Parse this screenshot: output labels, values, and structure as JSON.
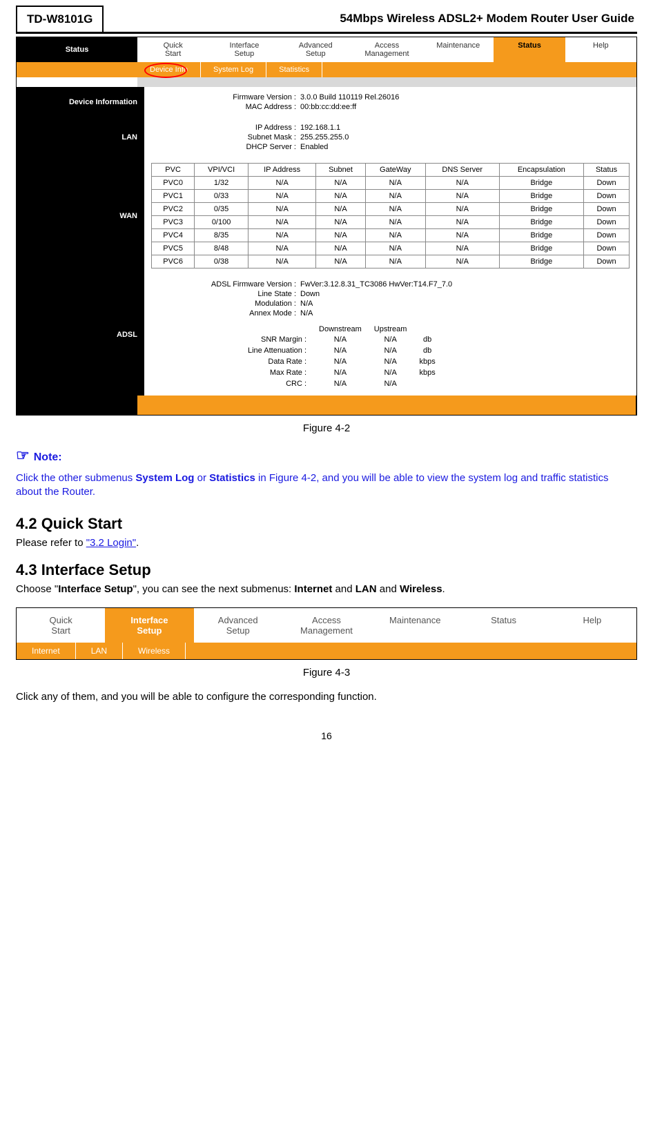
{
  "header": {
    "model": "TD-W8101G",
    "title": "54Mbps Wireless ADSL2+ Modem Router User Guide"
  },
  "shot1": {
    "sidebar_status": "Status",
    "tabs": [
      "Quick\nStart",
      "Interface\nSetup",
      "Advanced\nSetup",
      "Access\nManagement",
      "Maintenance",
      "Status",
      "Help"
    ],
    "active_tab": 5,
    "subtabs": [
      "Device Info",
      "System Log",
      "Statistics"
    ],
    "active_sub": 0,
    "section_device": "Device Information",
    "dev": {
      "fw_l": "Firmware Version :",
      "fw_v": "3.0.0 Build 110119 Rel.26016",
      "mac_l": "MAC Address :",
      "mac_v": "00:bb:cc:dd:ee:ff"
    },
    "section_lan": "LAN",
    "lan": {
      "ip_l": "IP Address :",
      "ip_v": "192.168.1.1",
      "sm_l": "Subnet Mask :",
      "sm_v": "255.255.255.0",
      "dh_l": "DHCP Server :",
      "dh_v": "Enabled"
    },
    "section_wan": "WAN",
    "wan_headers": [
      "PVC",
      "VPI/VCI",
      "IP Address",
      "Subnet",
      "GateWay",
      "DNS Server",
      "Encapsulation",
      "Status"
    ],
    "wan_rows": [
      [
        "PVC0",
        "1/32",
        "N/A",
        "N/A",
        "N/A",
        "N/A",
        "Bridge",
        "Down"
      ],
      [
        "PVC1",
        "0/33",
        "N/A",
        "N/A",
        "N/A",
        "N/A",
        "Bridge",
        "Down"
      ],
      [
        "PVC2",
        "0/35",
        "N/A",
        "N/A",
        "N/A",
        "N/A",
        "Bridge",
        "Down"
      ],
      [
        "PVC3",
        "0/100",
        "N/A",
        "N/A",
        "N/A",
        "N/A",
        "Bridge",
        "Down"
      ],
      [
        "PVC4",
        "8/35",
        "N/A",
        "N/A",
        "N/A",
        "N/A",
        "Bridge",
        "Down"
      ],
      [
        "PVC5",
        "8/48",
        "N/A",
        "N/A",
        "N/A",
        "N/A",
        "Bridge",
        "Down"
      ],
      [
        "PVC6",
        "0/38",
        "N/A",
        "N/A",
        "N/A",
        "N/A",
        "Bridge",
        "Down"
      ]
    ],
    "section_adsl": "ADSL",
    "adsl": {
      "fw_l": "ADSL Firmware Version :",
      "fw_v": "FwVer:3.12.8.31_TC3086 HwVer:T14.F7_7.0",
      "ls_l": "Line State :",
      "ls_v": "Down",
      "mod_l": "Modulation :",
      "mod_v": "N/A",
      "an_l": "Annex Mode :",
      "an_v": "N/A",
      "cols": [
        "Downstream",
        "Upstream",
        ""
      ],
      "rows": [
        [
          "SNR Margin :",
          "N/A",
          "N/A",
          "db"
        ],
        [
          "Line Attenuation :",
          "N/A",
          "N/A",
          "db"
        ],
        [
          "Data Rate :",
          "N/A",
          "N/A",
          "kbps"
        ],
        [
          "Max Rate :",
          "N/A",
          "N/A",
          "kbps"
        ],
        [
          "CRC :",
          "N/A",
          "N/A",
          ""
        ]
      ]
    }
  },
  "caption1": "Figure 4-2",
  "note_h": "Note:",
  "note_p_pre": "Click the other submenus ",
  "note_p_b1": "System Log",
  "note_p_mid": " or ",
  "note_p_b2": "Statistics",
  "note_p_post": " in Figure 4-2, and you will be able to view the system log and traffic statistics about the Router.",
  "sect42": "4.2    Quick Start",
  "p42_pre": "Please refer to ",
  "p42_link": "\"3.2 Login\"",
  "p42_post": ".",
  "sect43": "4.3    Interface Setup",
  "p43_pre": "Choose \"",
  "p43_b": "Interface Setup",
  "p43_mid": "\", you can see the next submenus: ",
  "p43_b2": "Internet",
  "p43_and": " and ",
  "p43_b3": "LAN",
  "p43_and2": " and ",
  "p43_b4": "Wireless",
  "p43_post": ".",
  "shot2": {
    "tabs": [
      {
        "l1": "Quick",
        "l2": "Start"
      },
      {
        "l1": "Interface",
        "l2": "Setup"
      },
      {
        "l1": "Advanced",
        "l2": "Setup"
      },
      {
        "l1": "Access",
        "l2": "Management"
      },
      {
        "l1": "Maintenance",
        "l2": ""
      },
      {
        "l1": "Status",
        "l2": ""
      },
      {
        "l1": "Help",
        "l2": ""
      }
    ],
    "active": 1,
    "subs": [
      "Internet",
      "LAN",
      "Wireless"
    ]
  },
  "caption2": "Figure 4-3",
  "bottom_p": "Click any of them, and you will be able to configure the corresponding function.",
  "pagenum": "16"
}
